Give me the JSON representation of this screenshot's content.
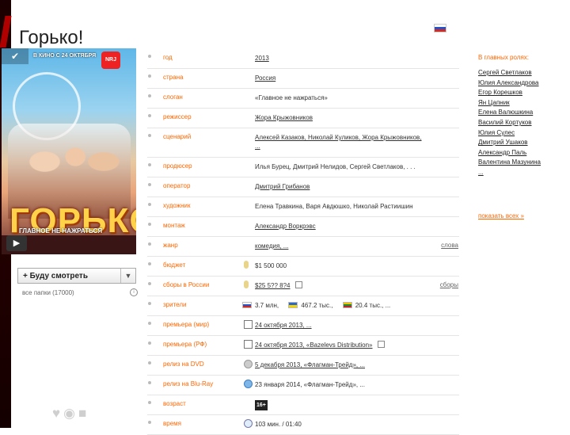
{
  "page": {
    "title": "Горько!"
  },
  "poster": {
    "release_text": "В КИНО С 24 ОКТЯБРЯ",
    "logo_text": "NRJ",
    "title": "ГОРЬКО!",
    "subtitle": "ГЛАВНОЕ НЕ НАЖРАТЬСЯ"
  },
  "sidebar": {
    "watch_label": "+ Буду смотреть",
    "all_lists": "все папки  (17000)"
  },
  "info": {
    "rows": [
      {
        "label": "год",
        "value": "2013"
      },
      {
        "label": "страна",
        "value": "Россия"
      },
      {
        "label": "слоган",
        "value": "«Главное не нажраться»"
      },
      {
        "label": "режиссер",
        "value": "Жора Крыжовников"
      },
      {
        "label": "сценарий",
        "value": "Алексей Казаков, Николай Куликов, Жора Крыжовников,",
        "value2": "..."
      },
      {
        "label": "продюсер",
        "value": "Илья Бурец, Дмитрий Нелидов, Сергей Светлаков, . . ."
      },
      {
        "label": "оператор",
        "value": "Дмитрий Грибанов"
      },
      {
        "label": "художник",
        "value": "Елена Травкина, Варя Авдюшко, Николай Растиишин"
      },
      {
        "label": "монтаж",
        "value": "Александр Воркрэвс"
      },
      {
        "label": "жанр",
        "value": "комедия, ...",
        "extra": "слова"
      },
      {
        "label": "бюджет",
        "value": "$1 500 000"
      },
      {
        "label": "сборы в России",
        "value": "$25 5?? 8?4",
        "extra": "сборы"
      },
      {
        "label": "зрители",
        "audience": [
          {
            "flag": "ru",
            "text": "3.7 млн,"
          },
          {
            "flag": "ua",
            "text": "467.2 тыс.,"
          },
          {
            "flag": "lt",
            "text": "20.4 тыс., ..."
          }
        ]
      },
      {
        "label": "премьера (мир)",
        "value": "24 октября 2013, ..."
      },
      {
        "label": "премьера (РФ)",
        "value": "24 октября 2013, «Bazelevs Distribution»"
      },
      {
        "label": "релиз на DVD",
        "value": "5 декабря 2013, «Флагман-Трейд», ..."
      },
      {
        "label": "релиз на Blu-Ray",
        "value": "23 января 2014, «Флагман-Трейд», ..."
      },
      {
        "label": "возраст",
        "value": "16+"
      },
      {
        "label": "время",
        "value": "103 мин. / 01:40"
      }
    ]
  },
  "cast": {
    "heading": "В главных ролях:",
    "items": [
      "Сергей Светлаков",
      "Юлия Александрова",
      "Егор Корешков",
      "Ян Цапник",
      "Елена Валюшкина",
      "Василий Кортуков",
      "Юлия Сулес",
      "Дмитрий Ушаков",
      "Александр Паль",
      "Валентина Мазунина"
    ],
    "more": "...",
    "show_all": "показать всех »"
  },
  "colors": {
    "label_orange": "#ff6600",
    "stripe_dark": "#1a0000"
  }
}
